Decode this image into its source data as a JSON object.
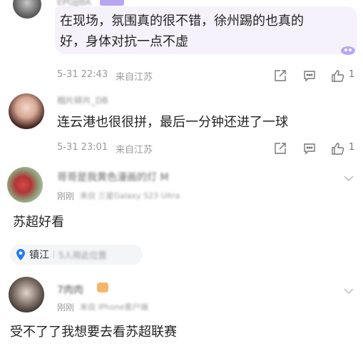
{
  "comments": [
    {
      "username": "EPGJJBA",
      "badge": "",
      "text_line1": "在现场，氛围真的很不错，徐州踢的也真的",
      "text_line2": "好，身体对抗一点不虚",
      "time": "5-31 22:43",
      "location": "来自江苏",
      "likes": "1"
    },
    {
      "username": "相片碎片_DB",
      "text": "连云港也很很拼，最后一分钟还进了一球",
      "time": "5-31 23:01",
      "location": "来自江苏",
      "likes": "1"
    },
    {
      "username": "哥哥是我黄色漫画的灯 M",
      "time": "刚刚",
      "device": "来自 三星Galaxy S23 Ultra",
      "text": "苏超好看",
      "location_tag": "镇江",
      "location_tag_sub": "5人用此位置"
    },
    {
      "username": "7肉肉",
      "time": "刚刚",
      "device": "来自 iPhone客户端",
      "text": "受不了了我想要去看苏超联赛"
    }
  ],
  "colors": {
    "bubble": "#f6f2fb",
    "meta_text": "#9a9a9a",
    "location_pin": "#1f7cf2",
    "badge": "#b9a6f3"
  }
}
